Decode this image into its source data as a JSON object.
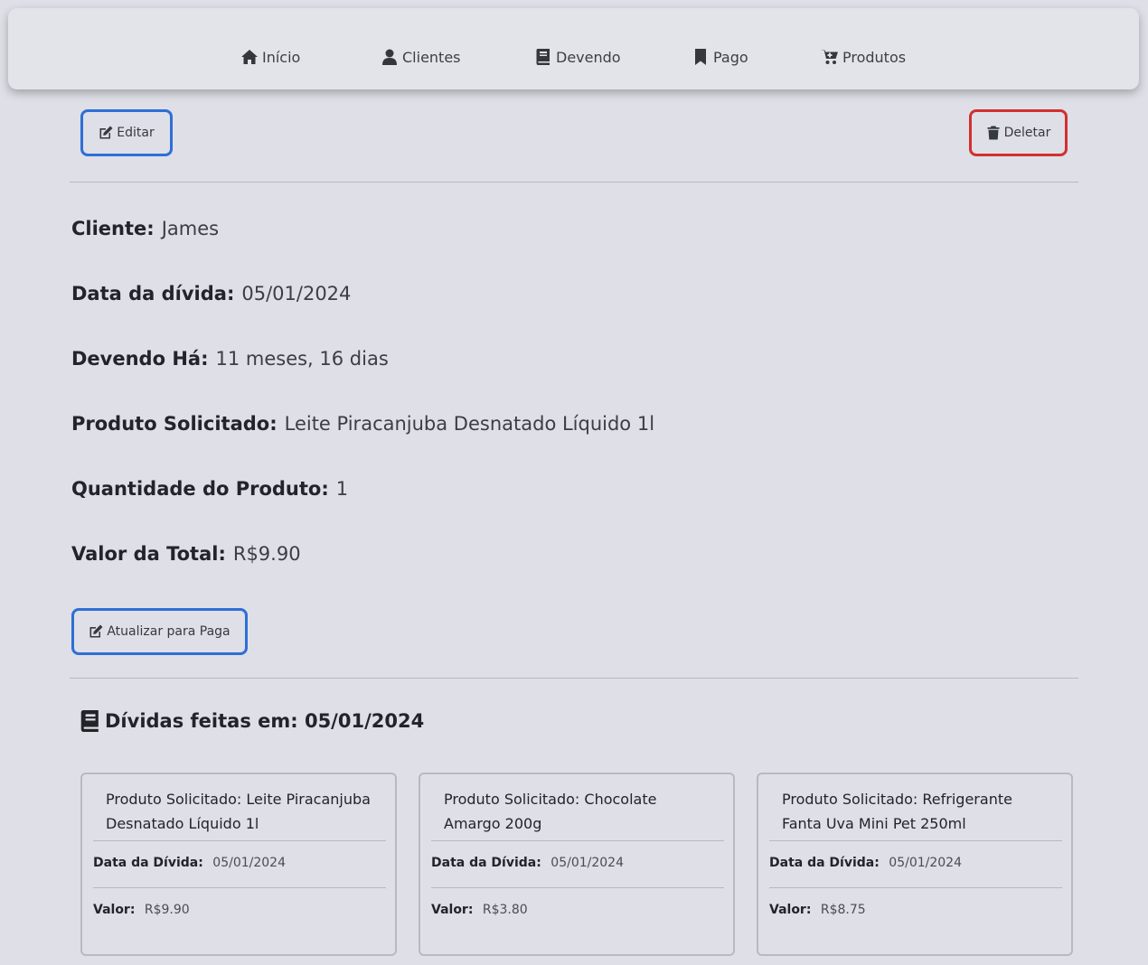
{
  "nav": {
    "items": [
      {
        "label": "Início",
        "icon": "home-icon"
      },
      {
        "label": "Clientes",
        "icon": "user-icon"
      },
      {
        "label": "Devendo",
        "icon": "book-icon"
      },
      {
        "label": "Pago",
        "icon": "bookmark-icon"
      },
      {
        "label": "Produtos",
        "icon": "cart-icon"
      }
    ]
  },
  "actions": {
    "edit_label": "Editar",
    "delete_label": "Deletar",
    "update_paid_label": "Atualizar para Paga"
  },
  "debt": {
    "fields": [
      {
        "label": "Cliente:",
        "value": "James"
      },
      {
        "label": "Data da dívida:",
        "value": "05/01/2024"
      },
      {
        "label": "Devendo Há:",
        "value": "11 meses, 16 dias"
      },
      {
        "label": "Produto Solicitado:",
        "value": "Leite Piracanjuba Desnatado Líquido 1l"
      },
      {
        "label": "Quantidade do Produto:",
        "value": "1"
      },
      {
        "label": "Valor da Total:",
        "value": "R$9.90"
      }
    ]
  },
  "debts_section": {
    "title": "Dívidas feitas em: 05/01/2024",
    "date_label": "Data da Dívida:",
    "value_label": "Valor:",
    "cards": [
      {
        "product": "Produto Solicitado: Leite Piracanjuba Desnatado Líquido 1l",
        "date": "05/01/2024",
        "value": "R$9.90"
      },
      {
        "product": "Produto Solicitado: Chocolate Amargo 200g",
        "date": "05/01/2024",
        "value": "R$3.80"
      },
      {
        "product": "Produto Solicitado: Refrigerante Fanta Uva Mini Pet 250ml",
        "date": "05/01/2024",
        "value": "R$8.75"
      }
    ]
  },
  "colors": {
    "background": "#dfdfe7",
    "primary_outline": "#2e6fd6",
    "danger_outline": "#d32f2f"
  }
}
